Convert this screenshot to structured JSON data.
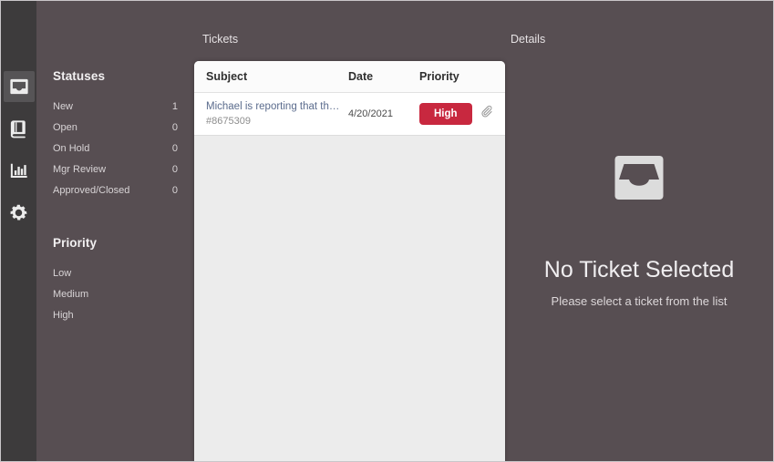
{
  "rail": {
    "items": [
      {
        "icon": "inbox-icon",
        "active": true
      },
      {
        "icon": "book-icon",
        "active": false
      },
      {
        "icon": "bar-chart-icon",
        "active": false
      },
      {
        "icon": "gear-icon",
        "active": false
      }
    ]
  },
  "sidebar": {
    "statuses_title": "Statuses",
    "statuses": [
      {
        "label": "New",
        "count": "1"
      },
      {
        "label": "Open",
        "count": "0"
      },
      {
        "label": "On Hold",
        "count": "0"
      },
      {
        "label": "Mgr Review",
        "count": "0"
      },
      {
        "label": "Approved/Closed",
        "count": "0"
      }
    ],
    "priority_title": "Priority",
    "priorities": [
      {
        "label": "Low"
      },
      {
        "label": "Medium"
      },
      {
        "label": "High"
      }
    ]
  },
  "columns": {
    "tickets_caption": "Tickets",
    "details_caption": "Details"
  },
  "list": {
    "headers": {
      "subject": "Subject",
      "date": "Date",
      "priority": "Priority"
    },
    "rows": [
      {
        "subject": "Michael is reporting that th…",
        "id": "#8675309",
        "date": "4/20/2021",
        "priority": "High",
        "has_attachment": true
      }
    ]
  },
  "details": {
    "empty_icon": "inbox-icon",
    "empty_title": "No Ticket Selected",
    "empty_subtitle": "Please select a ticket from the list"
  },
  "colors": {
    "panel_bg": "#574e52",
    "rail_bg": "#3d3b3c",
    "rail_active": "#565456",
    "list_bg": "#ececec",
    "row_bg": "#ffffff",
    "priority_high": "#c8283f",
    "subject_link": "#5b6c8d",
    "empty_icon": "#dcdcdc"
  }
}
